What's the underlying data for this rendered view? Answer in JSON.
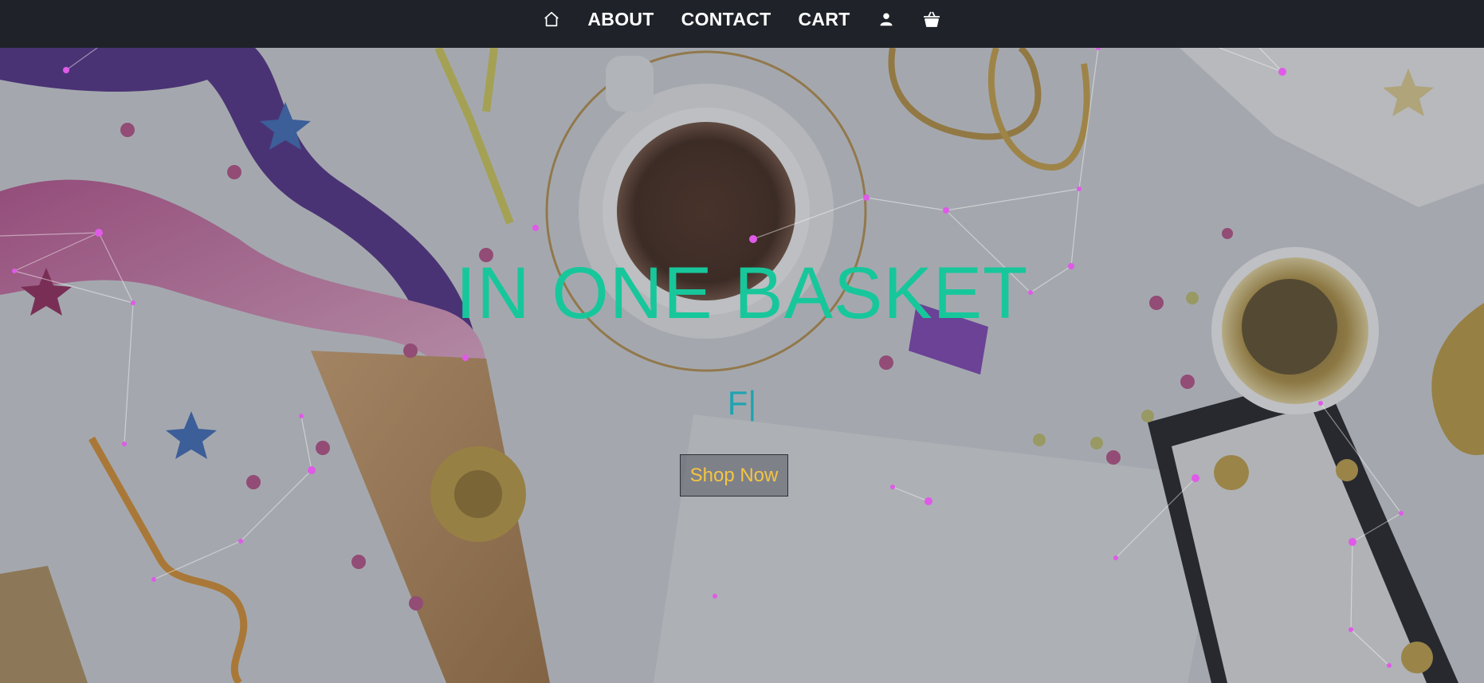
{
  "nav": {
    "items": [
      {
        "label": "ABOUT"
      },
      {
        "label": "CONTACT"
      },
      {
        "label": "CART"
      }
    ],
    "icons": {
      "home": "home-icon",
      "user": "user-icon",
      "basket": "basket-icon"
    }
  },
  "hero": {
    "title": "IN ONE BASKET",
    "typed_text": "F|",
    "button_label": "Shop Now"
  },
  "colors": {
    "navbar_bg": "#1f2329",
    "title": "#17c79b",
    "typed_text": "#20a3b0",
    "button_text": "#f4c542",
    "particle": "#d64fe0"
  }
}
